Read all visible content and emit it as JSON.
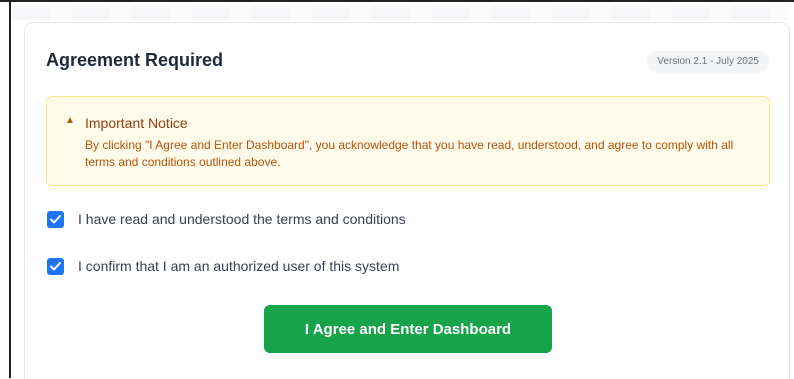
{
  "title": "Agreement Required",
  "version": "Version 2.1 - July 2025",
  "notice": {
    "icon": "warning-icon",
    "title": "Important Notice",
    "body": "By clicking \"I Agree and Enter Dashboard\", you acknowledge that you have read, understood, and agree to comply with all terms and conditions outlined above."
  },
  "checkboxes": [
    {
      "label": "I have read and understood the terms and conditions",
      "checked": true
    },
    {
      "label": "I confirm that I am an authorized user of this system",
      "checked": true
    }
  ],
  "cta_label": "I Agree and Enter Dashboard",
  "colors": {
    "accent": "#1d74f5",
    "cta": "#16a34a",
    "notice_bg": "#fffbeb",
    "notice_text": "#b45309"
  }
}
